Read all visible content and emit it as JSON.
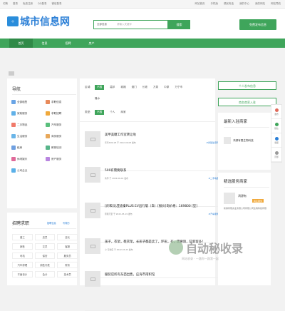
{
  "topbar": {
    "left": [
      "切换",
      "登录",
      "免费注册",
      "QQ登录",
      "微信登录"
    ],
    "right": [
      "网站首页",
      "手机版",
      "便民电话",
      "我的中心",
      "我的网站",
      "网站导航"
    ]
  },
  "header": {
    "logo_text": "城市信息网",
    "search_select": "全部信息",
    "search_placeholder": "请输入关键字",
    "search_button": "搜索",
    "publish_button": "免费发布信息"
  },
  "nav": {
    "items": [
      "首页",
      "信息",
      "招聘",
      "房产"
    ]
  },
  "sidebar": {
    "nav_title": "导航",
    "categories": [
      {
        "label": "全部租售",
        "color": "#6aa5e6"
      },
      {
        "label": "求职信息",
        "color": "#e88a5a"
      },
      {
        "label": "家政服务",
        "color": "#61b1e8"
      },
      {
        "label": "求职招聘",
        "color": "#f0a93c"
      },
      {
        "label": "二手物品",
        "color": "#f07a6a"
      },
      {
        "label": "汽车服务",
        "color": "#5abf7c"
      },
      {
        "label": "生活服务",
        "color": "#6ab5e8"
      },
      {
        "label": "商务服务",
        "color": "#e8a85a"
      },
      {
        "label": "租房",
        "color": "#6fa0e0"
      },
      {
        "label": "教育培训",
        "color": "#58b58a"
      },
      {
        "label": "休闲娱乐",
        "color": "#e06a9a"
      },
      {
        "label": "房产服务",
        "color": "#b985e0"
      },
      {
        "label": "公司企业",
        "color": "#5ab0e8"
      }
    ],
    "jobs_title": "招聘求职",
    "jobs_links": [
      "招聘信息",
      "写简历"
    ],
    "job_tags": [
      "普工",
      "店员",
      "店长",
      "销售",
      "文员",
      "客服",
      "司机",
      "保安",
      "服务员",
      "汽车修理",
      "销售代表",
      "财务",
      "平面设计",
      "会计",
      "技术员"
    ]
  },
  "filters": {
    "area_label": "区域:",
    "areas": [
      "不限",
      "嘉祁",
      "城厢",
      "澳门",
      "长坡",
      "万泉",
      "中原",
      "万宁市"
    ],
    "area_more": "隆水",
    "type_label": "类型:",
    "types": [
      "不限",
      "个人",
      "商家"
    ]
  },
  "listings": [
    {
      "title": "美甲美睫工作室转让啦",
      "meta": "乐乐446128 于 2022-06-08 发布",
      "category": "#商铺生意转"
    },
    {
      "title": "500有需要联系",
      "meta": "黄泽 于 2022-06-01 发布",
      "category": "#二手电器"
    },
    {
      "title": "[庆和]比亚迪秦PLUS EV出行版（白）[报价]询价格：169800 [型]",
      "meta": "奔腾万里 于 2022-05-19 发布",
      "category": "#汽车服务"
    },
    {
      "title": "孩子，衣架，鞋衣架，长形子都是卖了，环形，有，需要请，些新客多！",
      "meta": "小 马驹店 于 2022-03-25 发布",
      "category": ""
    },
    {
      "title": "服装店所有东西出售，应海市南积馆",
      "meta": "",
      "category": ""
    }
  ],
  "right": {
    "publish_person": "个人发布信息",
    "publish_merchant": "商务商家入驻",
    "new_title": "最新入驻商家",
    "new_merchant": "鸿源有限生物科技",
    "featured_title": "精选服务商家",
    "featured_name": "鸿源有",
    "featured_badge": "商业服务",
    "featured_desc": "新鲜有限资业务限公司有限公司生物科技有限"
  },
  "float": [
    "发布",
    "微信",
    "客服",
    "顶部"
  ],
  "watermark": {
    "title": "自动秘收录",
    "sub": "网站收录 · 一路你一路我一起"
  },
  "colors": {
    "brand_green": "#3fa55b",
    "brand_blue": "#2b7fd6"
  }
}
